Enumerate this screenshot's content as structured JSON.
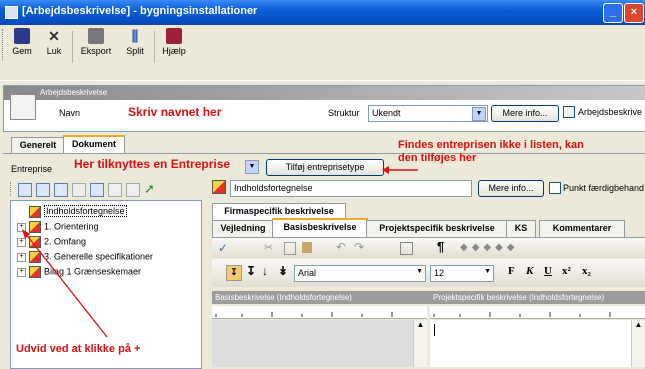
{
  "window": {
    "title": "[Arbejdsbeskrivelse] - bygningsinstallationer"
  },
  "toolbar": {
    "gem": "Gem",
    "luk": "Luk",
    "eksport": "Eksport",
    "split": "Split",
    "hjaelp": "Hjælp"
  },
  "header": {
    "ribbon": "Arbejdsbeskrivelse",
    "navn_label": "Navn",
    "navn_hint": "Skriv navnet her",
    "struktur_label": "Struktur",
    "struktur_value": "Ukendt",
    "mere_info": "Mere info...",
    "checkbox_label": "Arbejdsbeskrive"
  },
  "tabs": {
    "generelt": "Generelt",
    "dokument": "Dokument"
  },
  "entreprise": {
    "label": "Entreprise",
    "hint": "Her tilknyttes en Entreprise",
    "add_button": "Tilføj entreprisetype"
  },
  "annotations": {
    "top_note_line1": "Findes entreprisen ikke i listen, kan",
    "top_note_line2": "den tilføjes her",
    "expand_note": "Udvid ved at klikke på +"
  },
  "tree": [
    {
      "label": "Indholdsfortegnelse",
      "expandable": false,
      "selected": true
    },
    {
      "label": "1. Orientering",
      "expandable": true
    },
    {
      "label": "2. Omfang",
      "expandable": true
    },
    {
      "label": "3. Generelle specifikationer",
      "expandable": true
    },
    {
      "label": "Bilag 1 Grænseskemaer",
      "expandable": true
    }
  ],
  "doc": {
    "name_value": "Indholdsfortegnelse",
    "mere_info": "Mere info...",
    "checkbox_label": "Punkt færdigbehand"
  },
  "doc_tabs": {
    "firmaspecifik": "Firmaspecifik beskrivelse",
    "vejledning": "Vejledning",
    "basis": "Basisbeskrivelse",
    "projekt": "Projektspecifik beskrivelse",
    "ks": "KS",
    "kommentarer": "Kommentarer"
  },
  "format": {
    "font": "Arial",
    "size": "12"
  },
  "panes": {
    "left_header": "Basisbeskrivelse (Indholdsfortegnelse)",
    "right_header": "Projektspecifik beskrivelse (Indholdsfortegnelse)"
  },
  "colors": {
    "accent_red": "#e01010",
    "title_blue": "#0a5ed8",
    "tab_highlight": "#f5a623"
  }
}
